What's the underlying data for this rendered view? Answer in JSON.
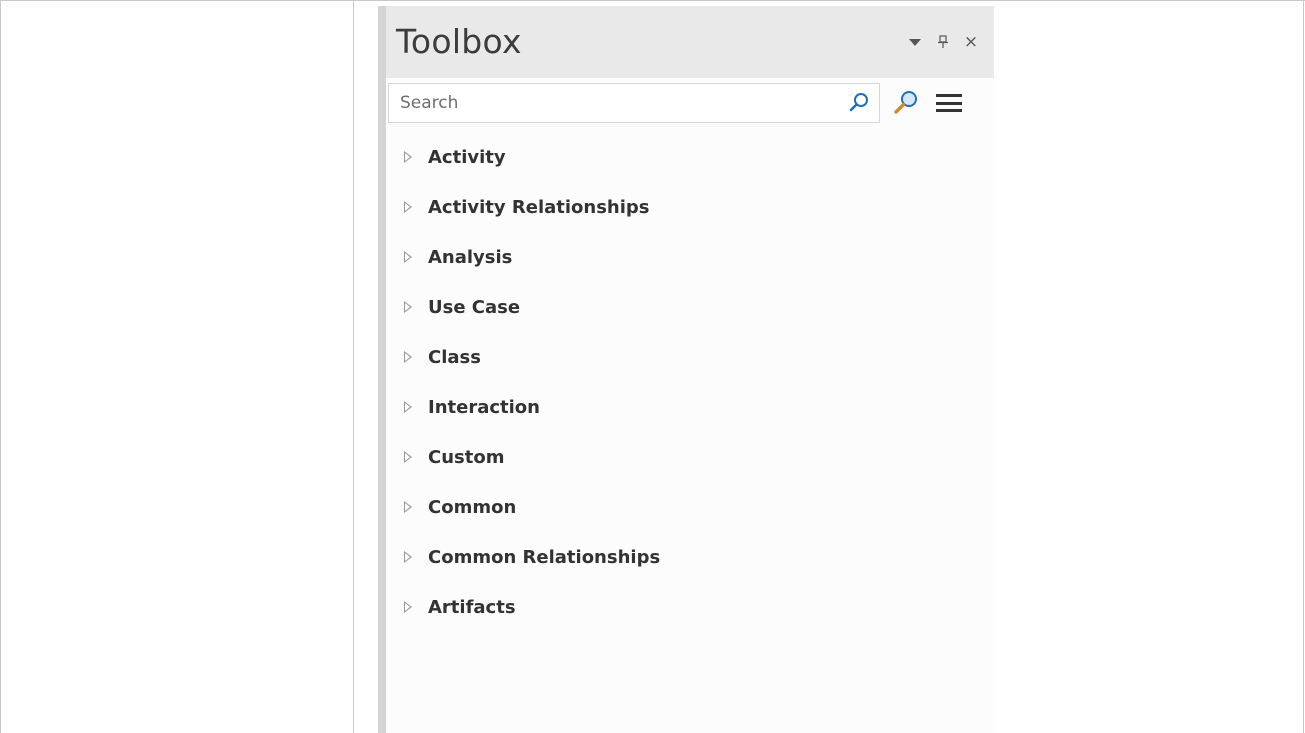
{
  "toolbox": {
    "title": "Toolbox",
    "controls": {
      "dropdown_icon": "dropdown-arrow-icon",
      "pin_glyph": "ᵖ",
      "close_glyph": "×"
    },
    "search": {
      "placeholder": "Search",
      "value": ""
    },
    "groups": [
      {
        "label": "Activity"
      },
      {
        "label": "Activity Relationships"
      },
      {
        "label": "Analysis"
      },
      {
        "label": "Use Case"
      },
      {
        "label": "Class"
      },
      {
        "label": "Interaction"
      },
      {
        "label": "Custom"
      },
      {
        "label": "Common"
      },
      {
        "label": "Common Relationships"
      },
      {
        "label": "Artifacts"
      }
    ]
  },
  "colors": {
    "accent_blue": "#1f6fb8",
    "header_bg": "#e9e9e9",
    "panel_bg": "#fcfcfc"
  }
}
